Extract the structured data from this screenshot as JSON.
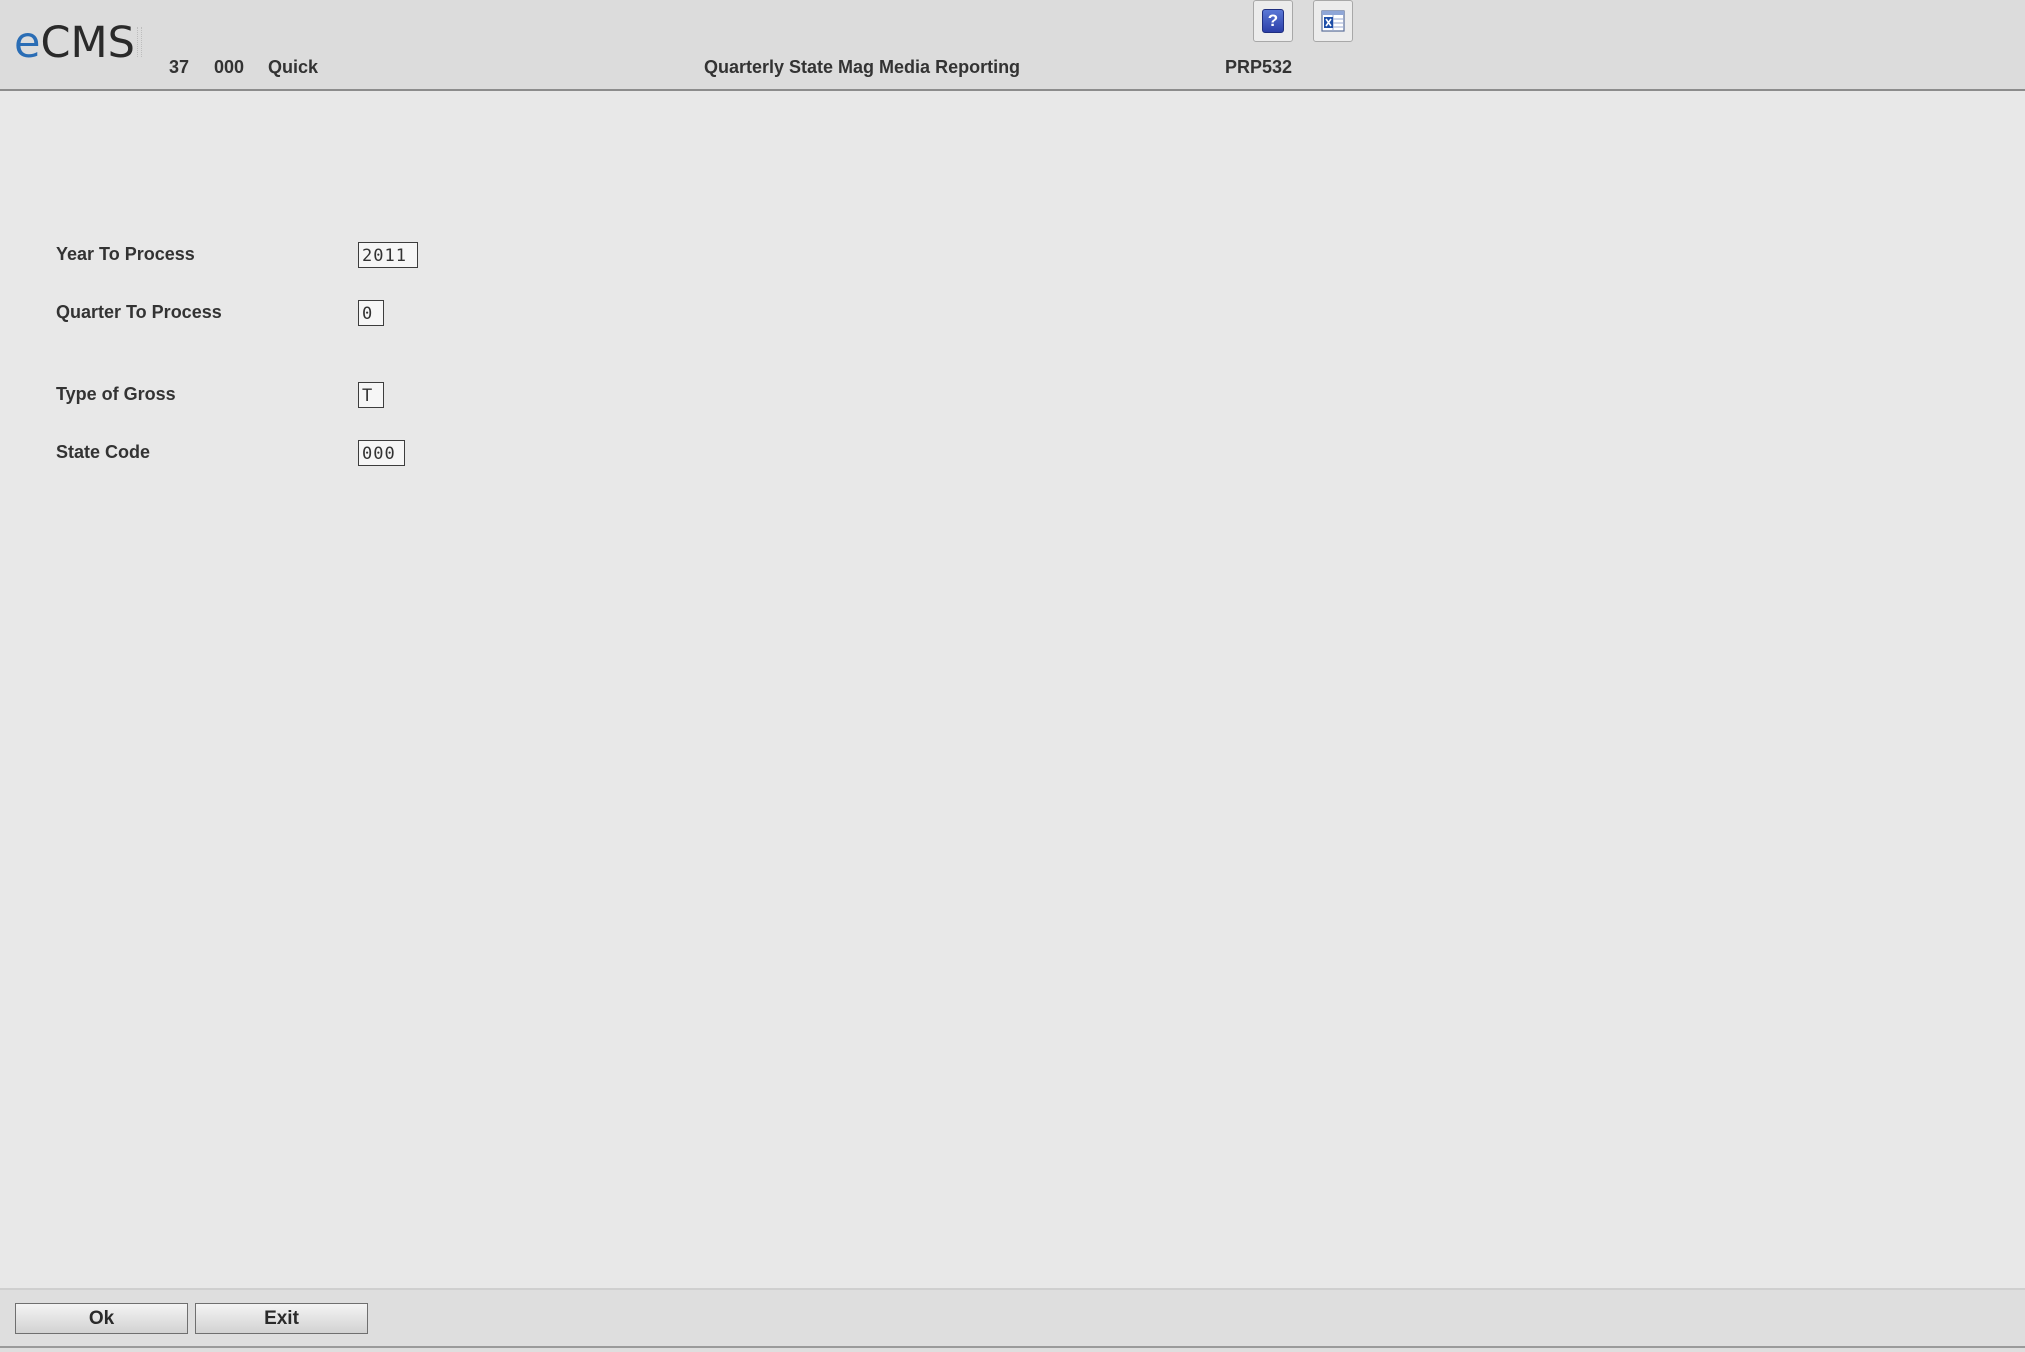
{
  "header": {
    "logo_prefix": "e",
    "logo_suffix": "CMS",
    "company": "37",
    "division": "000",
    "user": "Quick",
    "title": "Quarterly State Mag Media Reporting",
    "program_id": "PRP532",
    "help_button_glyph": "?",
    "help_icon": "help-icon",
    "export_icon": "excel-export-icon"
  },
  "form": {
    "year": {
      "label": "Year To Process",
      "value": "2011"
    },
    "quarter": {
      "label": "Quarter To Process",
      "value": "0"
    },
    "gross_type": {
      "label": "Type of Gross",
      "value": "T"
    },
    "state_code": {
      "label": "State Code",
      "value": "000"
    }
  },
  "footer": {
    "ok_label": "Ok",
    "exit_label": "Exit"
  }
}
